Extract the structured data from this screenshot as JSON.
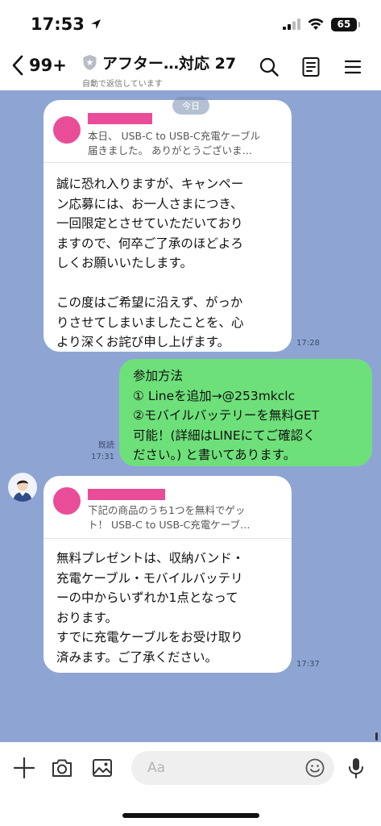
{
  "status_bar": {
    "time": "17:53",
    "battery": "65"
  },
  "header": {
    "unread_count": "99+",
    "title": "アフター…対応 27",
    "subtitle": "自動で返信しています"
  },
  "chat": {
    "date_divider": "今日",
    "messages": [
      {
        "quote_text": "本日、 USB-C to USB-C充電ケーブル\n届きました。 ありがとうございま…",
        "text": "誠に恐れ入りますが、キャンペー\nン応募には、お一人さまにつき、\n一回限定とさせていただいており\nますので、何卒ご了承のほどよろ\nしくお願いいたします。\n\nこの度はご希望に沿えず、がっか\nりさせてしまいましたことを、心\nより深くお詫び申し上げます。",
        "time": "17:28"
      },
      {
        "text": "参加方法\n① Lineを追加→@253mkclc\n②モバイルバッテリーを無料GET\n可能！(詳細はLINEにてご確認く\nださい。) と書いてあります。",
        "read_label": "既読",
        "time": "17:31"
      },
      {
        "quote_text": "下記の商品のうち1つを無料でゲッ\nト！ USB-C to USB-C充電ケーブ…",
        "text": "無料プレゼントは、収納バンド・\n充電ケーブル・モバイルバッテリ\nーの中からいずれか1点となって\nおります。\nすでに充電ケーブルをお受け取り\n済みます。ご了承ください。",
        "time": "17:37"
      }
    ]
  },
  "input_bar": {
    "placeholder": "Aa"
  },
  "colors": {
    "chat_background": "#8ea5d4",
    "outgoing_bubble": "#6ee07a",
    "redaction": "#ea4d98"
  }
}
